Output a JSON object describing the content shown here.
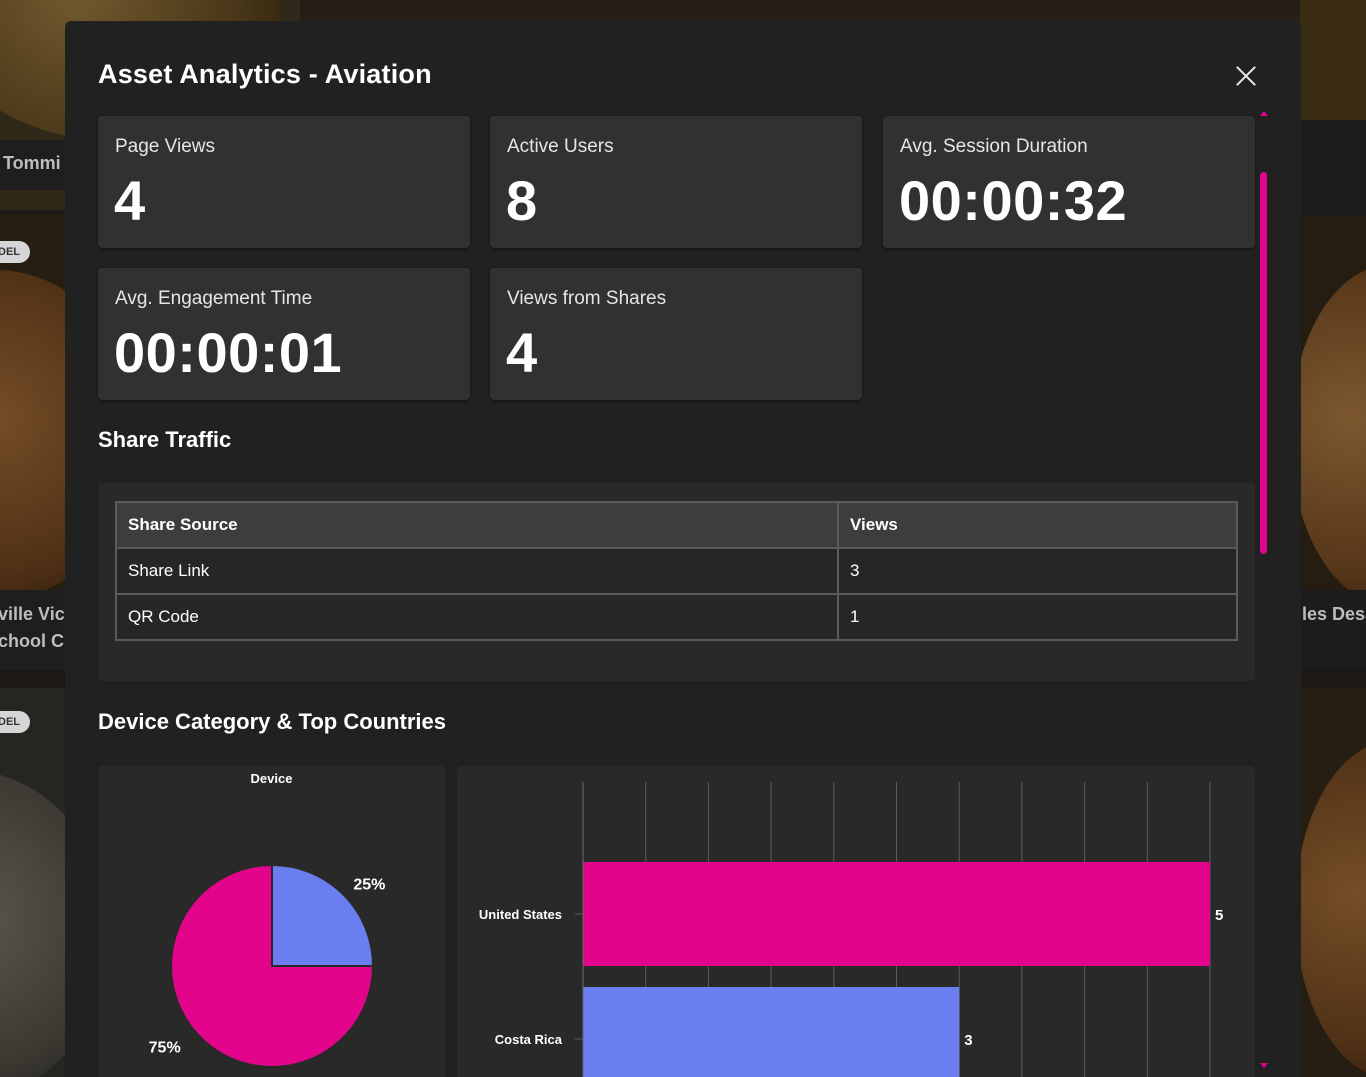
{
  "modal": {
    "title": "Asset Analytics - Aviation"
  },
  "background": {
    "texts": [
      "Tommi",
      "ville Vict",
      "chool C",
      "les Desa"
    ],
    "badges": [
      "DEL",
      "DEL"
    ]
  },
  "stats": [
    {
      "label": "Page Views",
      "value": "4"
    },
    {
      "label": "Active Users",
      "value": "8"
    },
    {
      "label": "Avg. Session Duration",
      "value": "00:00:32"
    },
    {
      "label": "Avg. Engagement Time",
      "value": "00:00:01"
    },
    {
      "label": "Views from Shares",
      "value": "4"
    }
  ],
  "share_traffic": {
    "title": "Share Traffic",
    "headers": [
      "Share Source",
      "Views"
    ],
    "rows": [
      [
        "Share Link",
        "3"
      ],
      [
        "QR Code",
        "1"
      ]
    ]
  },
  "device_section": {
    "title": "Device Category & Top Countries"
  },
  "colors": {
    "accent": "#e2058b",
    "secondary": "#6b7ef0",
    "card": "#313131",
    "modal": "#212121"
  },
  "chart_data": [
    {
      "type": "pie",
      "title": "Device",
      "slices": [
        {
          "label": "25%",
          "value": 25,
          "color": "#6b7ef0"
        },
        {
          "label": "75%",
          "value": 75,
          "color": "#e2058b"
        }
      ]
    },
    {
      "type": "bar",
      "orientation": "horizontal",
      "categories": [
        "United States",
        "Costa Rica"
      ],
      "values": [
        5,
        3
      ],
      "colors": [
        "#e2058b",
        "#6b7ef0"
      ],
      "xlim": [
        0,
        5
      ],
      "grid": true
    }
  ]
}
